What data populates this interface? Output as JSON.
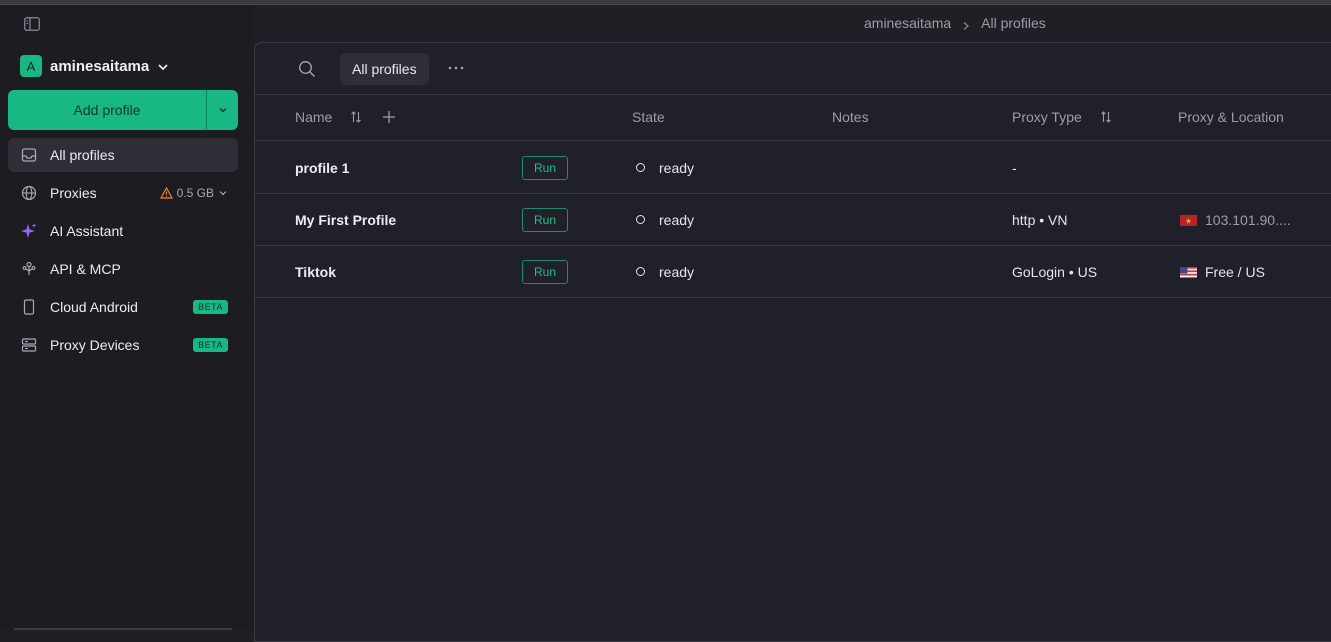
{
  "account": {
    "initial": "A",
    "name": "aminesaitama"
  },
  "sidebar": {
    "add_profile_label": "Add profile",
    "items": [
      {
        "id": "all-profiles",
        "label": "All profiles",
        "icon": "inbox-icon",
        "active": true
      },
      {
        "id": "proxies",
        "label": "Proxies",
        "icon": "globe-icon",
        "extra": "0.5 GB"
      },
      {
        "id": "ai-assistant",
        "label": "AI Assistant",
        "icon": "sparkle-icon"
      },
      {
        "id": "api-mcp",
        "label": "API & MCP",
        "icon": "api-icon"
      },
      {
        "id": "cloud-android",
        "label": "Cloud Android",
        "icon": "phone-icon",
        "badge": "BETA"
      },
      {
        "id": "proxy-devices",
        "label": "Proxy Devices",
        "icon": "server-icon",
        "badge": "BETA"
      }
    ]
  },
  "breadcrumb": {
    "account": "aminesaitama",
    "current": "All profiles"
  },
  "toolbar": {
    "tab_label": "All profiles"
  },
  "table": {
    "headers": {
      "name": "Name",
      "state": "State",
      "notes": "Notes",
      "proxy_type": "Proxy Type",
      "proxy_location": "Proxy & Location"
    },
    "run_label": "Run",
    "rows": [
      {
        "name": "profile 1",
        "state": "ready",
        "proxy_type": "-",
        "location": "",
        "flag": ""
      },
      {
        "name": "My First Profile",
        "state": "ready",
        "proxy_type": "http • VN",
        "location": "103.101.90....",
        "flag": "vn-flag-icon"
      },
      {
        "name": "Tiktok",
        "state": "ready",
        "proxy_type": "GoLogin • US",
        "location": "Free / US",
        "flag": "us-flag-icon"
      }
    ]
  },
  "colors": {
    "accent": "#17b884",
    "background": "#1f1f26",
    "sidebar": "#1c1c22",
    "warning": "#e8873a"
  }
}
